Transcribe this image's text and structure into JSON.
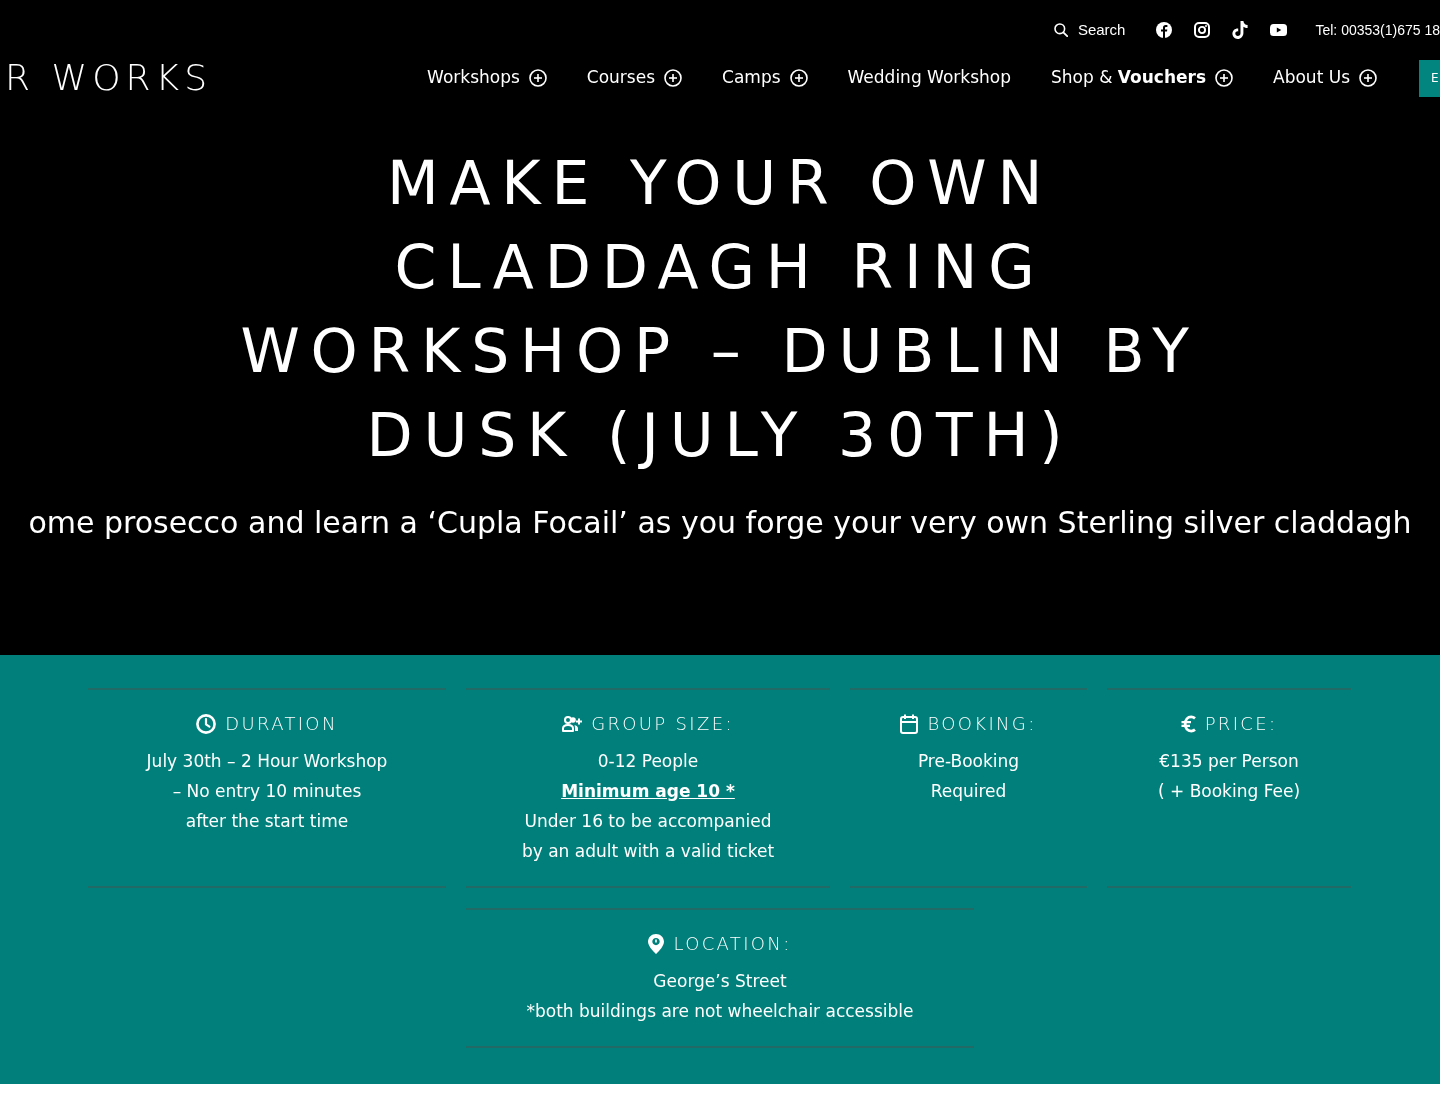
{
  "top_bar": {
    "search": "Search",
    "phone": "Tel: 00353(1)675 18"
  },
  "logo": "R WORKS",
  "nav": [
    {
      "label": "Workshops",
      "dropdown": true
    },
    {
      "label": "Courses",
      "dropdown": true
    },
    {
      "label": "Camps",
      "dropdown": true
    },
    {
      "label": "Wedding Workshop",
      "dropdown": false
    },
    {
      "label": "Shop & **Vouchers**",
      "dropdown": true
    },
    {
      "label": "About Us",
      "dropdown": true
    }
  ],
  "cta_button": "E",
  "hero": {
    "title": "MAKE YOUR OWN CLADDAGH RING WORKSHOP – DUBLIN BY DUSK (JULY 30TH)",
    "subtitle": "ome prosecco and learn a ‘Cupla Focail’ as you forge your very own Sterling silver claddagh"
  },
  "details": [
    {
      "heading": "DURATION",
      "lines": [
        {
          "kind": "text",
          "text": "July 30th – 2 Hour Workshop"
        },
        {
          "kind": "text",
          "text": "– No entry 10 minutes"
        },
        {
          "kind": "text",
          "text": "after the start time"
        }
      ]
    },
    {
      "heading": "GROUP SIZE:",
      "lines": [
        {
          "kind": "text",
          "text": "0-12 People"
        },
        {
          "kind": "link",
          "text": "Minimum age 10 *"
        },
        {
          "kind": "text",
          "text": "Under 16 to be accompanied"
        },
        {
          "kind": "text",
          "text": "by an adult with a valid ticket"
        }
      ]
    },
    {
      "heading": "BOOKING:",
      "lines": [
        {
          "kind": "text",
          "text": "Pre-Booking"
        },
        {
          "kind": "text",
          "text": "Required"
        }
      ]
    },
    {
      "heading": "PRICE:",
      "lines": [
        {
          "kind": "text",
          "text": "€135 per Person"
        },
        {
          "kind": "text",
          "text": "( + Booking Fee)"
        }
      ]
    }
  ],
  "location": {
    "heading": "LOCATION:",
    "lines": [
      {
        "kind": "text",
        "text": "George’s Street"
      },
      {
        "kind": "text",
        "text": "*both buildings are not wheelchair accessible"
      }
    ]
  }
}
